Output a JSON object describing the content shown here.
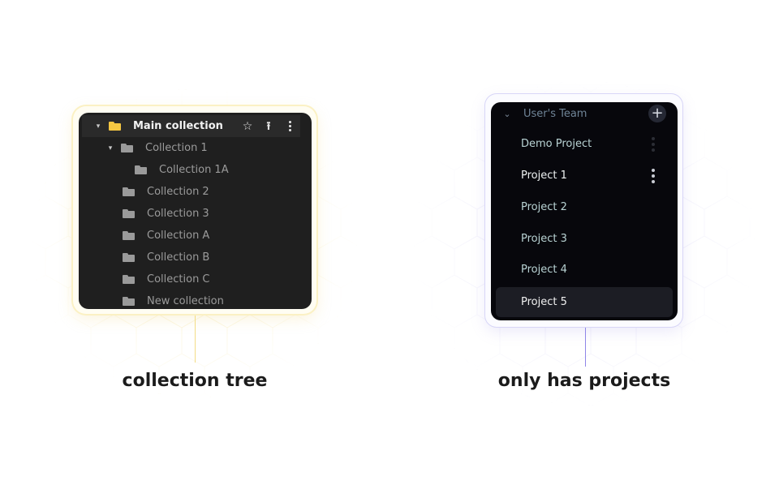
{
  "left": {
    "caption": "collection tree",
    "accent": "#f5c742",
    "main_row": {
      "label": "Main collection",
      "icons": [
        "caret-down-icon",
        "folder-icon",
        "star-icon",
        "upload-icon",
        "more-vertical-icon"
      ]
    },
    "items": [
      {
        "label": "Collection 1",
        "level": 1,
        "expanded": true
      },
      {
        "label": "Collection 1A",
        "level": 2,
        "expanded": false
      },
      {
        "label": "Collection 2",
        "level": 1,
        "expanded": false
      },
      {
        "label": "Collection 3",
        "level": 1,
        "expanded": false
      },
      {
        "label": "Collection A",
        "level": 1,
        "expanded": false
      },
      {
        "label": "Collection B",
        "level": 1,
        "expanded": false
      },
      {
        "label": "Collection C",
        "level": 1,
        "expanded": false
      },
      {
        "label": "New collection",
        "level": 1,
        "expanded": false
      }
    ]
  },
  "right": {
    "caption": "only has projects",
    "accent": "#8f86e8",
    "team": {
      "label": "User's Team",
      "add_icon": "plus-icon",
      "caret_icon": "chevron-down-icon"
    },
    "projects": [
      {
        "label": "Demo Project"
      },
      {
        "label": "Project 1"
      },
      {
        "label": "Project 2"
      },
      {
        "label": "Project 3"
      },
      {
        "label": "Project 4"
      },
      {
        "label": "Project 5"
      }
    ],
    "selected_project": "Project 5"
  },
  "glyphs": {
    "caret": "▾",
    "star": "☆",
    "upload": "⭱",
    "plus": "+",
    "chevron": "⌄"
  }
}
